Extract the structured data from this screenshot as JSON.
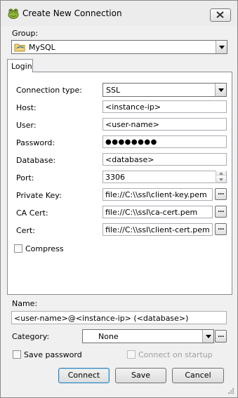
{
  "window": {
    "title": "Create New Connection",
    "app_icon": "toad-frog-icon"
  },
  "group": {
    "label": "Group:",
    "value": "MySQL",
    "icon": "mysql-folder-icon"
  },
  "tabs": [
    {
      "label": "Login"
    }
  ],
  "login": {
    "connection_type": {
      "label": "Connection type:",
      "value": "SSL"
    },
    "host": {
      "label": "Host:",
      "value": "<instance-ip>"
    },
    "user": {
      "label": "User:",
      "value": "<user-name>"
    },
    "password": {
      "label": "Password:",
      "value": "●●●●●●●●"
    },
    "database": {
      "label": "Database:",
      "value": "<database>"
    },
    "port": {
      "label": "Port:",
      "value": "3306"
    },
    "private_key": {
      "label": "Private Key:",
      "value": "file://C:\\\\ssl\\client-key.pem"
    },
    "ca_cert": {
      "label": "CA Cert:",
      "value": "file://C:\\\\ssl\\ca-cert.pem"
    },
    "cert": {
      "label": "Cert:",
      "value": "file://C:\\\\ssl\\client-cert.pem"
    },
    "compress": {
      "label": "Compress",
      "checked": false
    },
    "browse_label": "..."
  },
  "name": {
    "label": "Name:",
    "value": "<user-name>@<instance-ip> (<database>)"
  },
  "category": {
    "label": "Category:",
    "value": "None",
    "more_label": "..."
  },
  "save_password": {
    "label": "Save password",
    "checked": false
  },
  "connect_on_startup": {
    "label": "Connect on startup",
    "checked": false,
    "enabled": false
  },
  "buttons": {
    "connect": "Connect",
    "save": "Save",
    "cancel": "Cancel"
  },
  "colors": {
    "default_button_border": "#3c7fb1",
    "disabled_text": "#a0a0a0"
  }
}
